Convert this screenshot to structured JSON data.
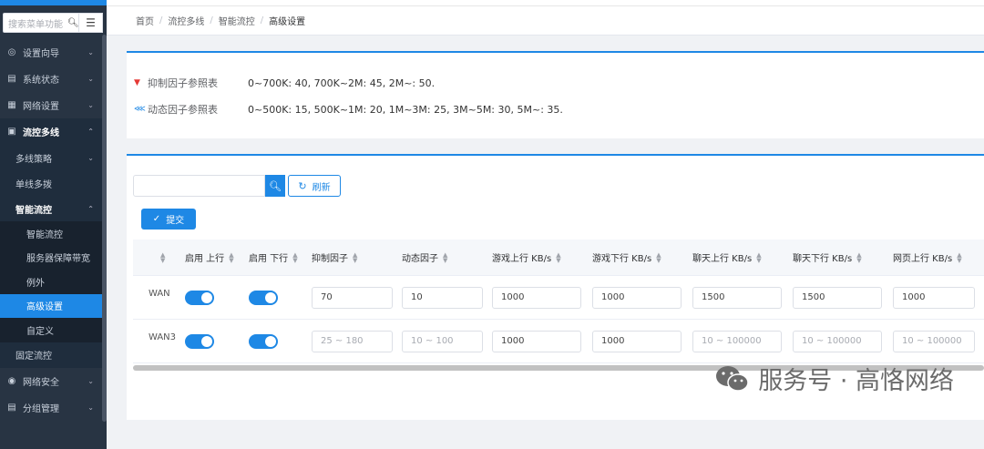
{
  "sidebar": {
    "search_placeholder": "搜索菜单功能",
    "items": [
      {
        "label": "设置向导",
        "icon": "compass-icon"
      },
      {
        "label": "系统状态",
        "icon": "chart-icon"
      },
      {
        "label": "网络设置",
        "icon": "network-icon"
      },
      {
        "label": "流控多线",
        "icon": "flow-icon"
      },
      {
        "label": "多线策略"
      },
      {
        "label": "单线多拨"
      },
      {
        "label": "智能流控"
      },
      {
        "label": "智能流控"
      },
      {
        "label": "服务器保障带宽"
      },
      {
        "label": "例外"
      },
      {
        "label": "高级设置"
      },
      {
        "label": "自定义"
      },
      {
        "label": "固定流控"
      },
      {
        "label": "网络安全",
        "icon": "globe-icon"
      },
      {
        "label": "分组管理",
        "icon": "group-icon"
      }
    ]
  },
  "breadcrumb": [
    "首页",
    "流控多线",
    "智能流控",
    "高级设置"
  ],
  "refs": {
    "suppress_label": "抑制因子参照表",
    "suppress_value": "0~700K: 40, 700K~2M: 45, 2M~: 50.",
    "dynamic_label": "动态因子参照表",
    "dynamic_value": "0~500K: 15, 500K~1M: 20, 1M~3M: 25, 3M~5M: 30, 5M~: 35."
  },
  "toolbar": {
    "search_value": "",
    "refresh_label": "刷新",
    "submit_label": "提交"
  },
  "table": {
    "headers": [
      "",
      "启用 上行",
      "启用 下行",
      "抑制因子",
      "动态因子",
      "游戏上行 KB/s",
      "游戏下行 KB/s",
      "聊天上行 KB/s",
      "聊天下行 KB/s",
      "网页上行 KB/s"
    ],
    "rows": [
      {
        "name": "WAN",
        "cells": [
          "70",
          "10",
          "1000",
          "1000",
          "1500",
          "1500",
          "1000"
        ],
        "placeholder": [
          false,
          false,
          false,
          false,
          false,
          false,
          false
        ]
      },
      {
        "name": "WAN3",
        "cells": [
          "25 ~ 180",
          "10 ~ 100",
          "1000",
          "1000",
          "10 ~ 100000",
          "10 ~ 100000",
          "10 ~ 100000"
        ],
        "placeholder": [
          true,
          true,
          false,
          false,
          true,
          true,
          true
        ]
      }
    ]
  },
  "watermark": "服务号 · 高恪网络",
  "colors": {
    "accent": "#1e88e5",
    "sidebar_bg": "#283443"
  }
}
